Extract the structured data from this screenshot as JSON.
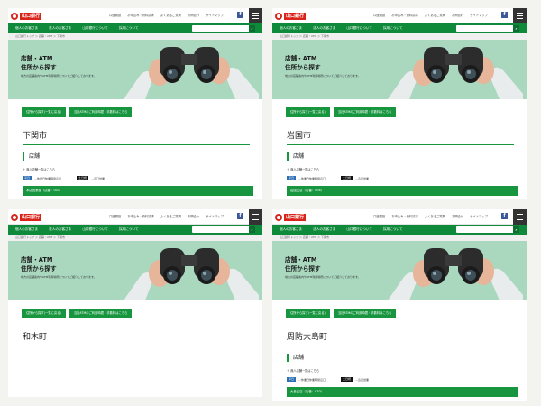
{
  "header": {
    "logo_text": "山口銀行",
    "util_links": [
      "口座開設",
      "お申込み・資料請求",
      "よくあるご質問",
      "お問合わ",
      "サイトマップ"
    ],
    "fb_label": "f"
  },
  "nav": {
    "items": [
      "個人のお客さま",
      "法人のお客さま",
      "山口銀行について",
      "採用について"
    ],
    "search_icon": "search-icon"
  },
  "breadcrumb": "山口銀行トップ ＞ 店舗・ATM ＞ 下関市",
  "hero": {
    "title_line1": "店舗・ATM",
    "title_line2": "住所から探す",
    "subtitle": "地方の店舗案内やATM利用場所についてご紹介しております。"
  },
  "buttons": {
    "from_address": "住所から探す(一覧に戻る)",
    "from_atm": "当社ATMのご利用時間・手数料はこちら"
  },
  "section": {
    "title": "店舗",
    "list_link": "無人店舗一覧はこちら",
    "tag_blue": "平日",
    "tag_blue_text": "…休業日休業時間窓口",
    "tag_black": "土日祝",
    "tag_black_text": "…窓口営業"
  },
  "panels": [
    {
      "city": "下関市",
      "branch": "本店営業部（店番：001）",
      "show_section": true
    },
    {
      "city": "岩国市",
      "branch": "岩国支店（店番：006）",
      "show_section": true
    },
    {
      "city": "和木町",
      "branch": "",
      "show_section": false
    },
    {
      "city": "周防大島町",
      "branch": "大島支店（店番：070）",
      "show_section": true
    }
  ],
  "colors": {
    "brand_green": "#17963f",
    "nav_green": "#0f8a3b",
    "hero_bg": "#a9d8bf",
    "logo_red": "#d9241b"
  }
}
